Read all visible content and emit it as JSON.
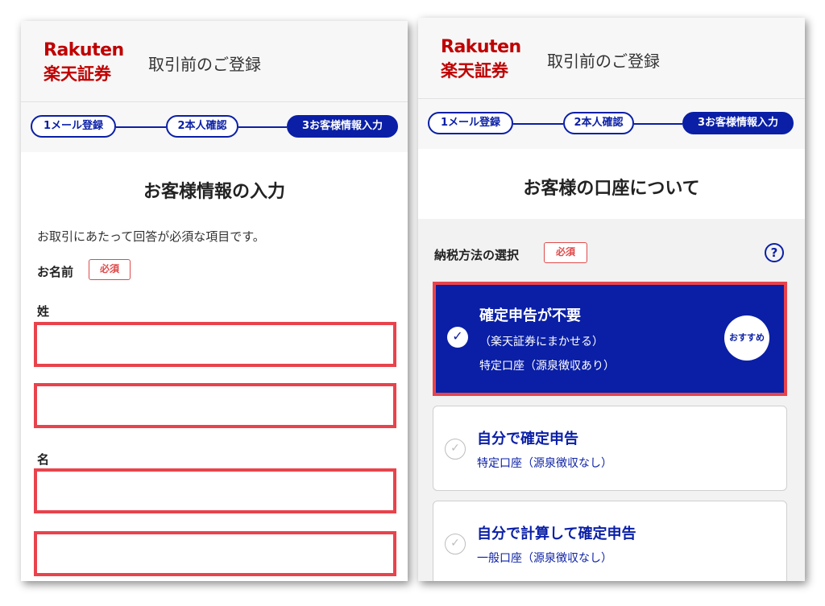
{
  "left": {
    "logo": {
      "en": "Rakuten",
      "ja": "楽天証券"
    },
    "header_title": "取引前のご登録",
    "steps": [
      {
        "label": "1メール登録",
        "active": false
      },
      {
        "label": "2本人確認",
        "active": false
      },
      {
        "label": "3お客様情報入力",
        "active": true
      }
    ],
    "section_title": "お客様情報の入力",
    "description": "お取引にあたって回答が必須な項目です。",
    "name_label": "お名前",
    "required_badge": "必須",
    "surname_label": "姓",
    "given_name_label": "名",
    "inputs": {
      "surname": "",
      "surname_kana": "",
      "given": "",
      "given_kana": ""
    }
  },
  "right": {
    "logo": {
      "en": "Rakuten",
      "ja": "楽天証券"
    },
    "header_title": "取引前のご登録",
    "steps": [
      {
        "label": "1メール登録",
        "active": false
      },
      {
        "label": "2本人確認",
        "active": false
      },
      {
        "label": "3お客様情報入力",
        "active": true
      }
    ],
    "section_title": "お客様の口座について",
    "tax_label": "納税方法の選択",
    "required_badge": "必須",
    "help_icon": "?",
    "options": [
      {
        "title": "確定申告が不要",
        "sub1": "（楽天証券にまかせる）",
        "sub2": "特定口座（源泉徴収あり）",
        "selected": true,
        "badge": "おすすめ"
      },
      {
        "title": "自分で確定申告",
        "sub1": "特定口座（源泉徴収なし）",
        "selected": false
      },
      {
        "title": "自分で計算して確定申告",
        "sub1": "一般口座（源泉徴収なし）",
        "selected": false
      }
    ],
    "colors": {
      "brand_red": "#bf0000",
      "primary_blue": "#0a1fa6",
      "highlight_red": "#e8434c"
    }
  }
}
